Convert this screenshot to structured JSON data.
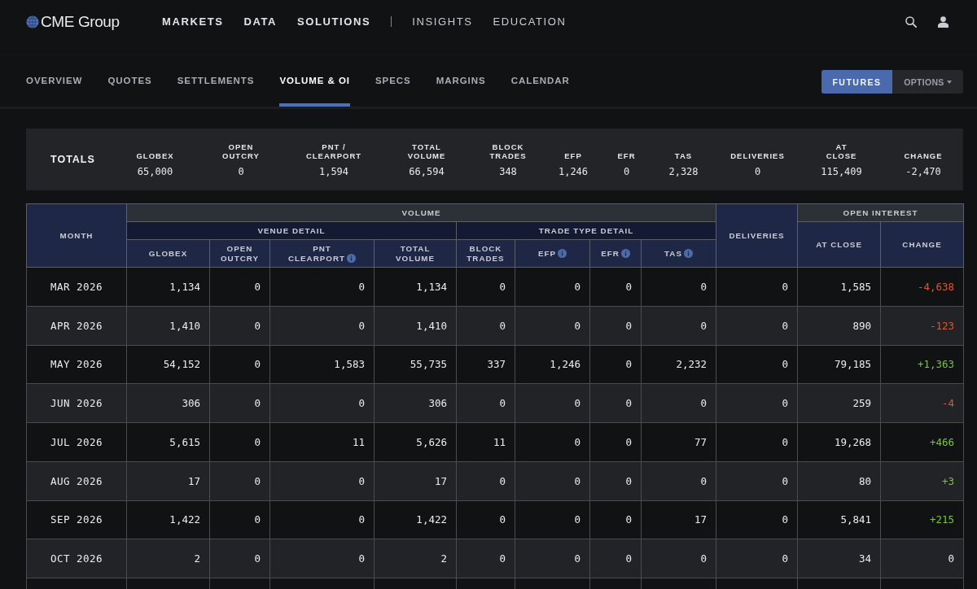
{
  "header": {
    "logo": "CME Group",
    "primary_nav": [
      {
        "label": "MARKETS"
      },
      {
        "label": "DATA"
      },
      {
        "label": "SOLUTIONS"
      }
    ],
    "secondary_nav": [
      {
        "label": "INSIGHTS"
      },
      {
        "label": "EDUCATION"
      }
    ]
  },
  "subnav": {
    "tabs": [
      {
        "label": "OVERVIEW",
        "selected": false
      },
      {
        "label": "QUOTES",
        "selected": false
      },
      {
        "label": "SETTLEMENTS",
        "selected": false
      },
      {
        "label": "VOLUME & OI",
        "selected": true
      },
      {
        "label": "SPECS",
        "selected": false
      },
      {
        "label": "MARGINS",
        "selected": false
      },
      {
        "label": "CALENDAR",
        "selected": false
      }
    ],
    "product_toggle": [
      {
        "label": "FUTURES",
        "selected": true,
        "menu": false
      },
      {
        "label": "OPTIONS",
        "selected": false,
        "menu": true
      }
    ]
  },
  "totals": {
    "title": "TOTALS",
    "columns": [
      {
        "label": "GLOBEX",
        "value": "65,000"
      },
      {
        "label": "OPEN\nOUTCRY",
        "value": "0"
      },
      {
        "label": "PNT /\nCLEARPORT",
        "value": "1,594"
      },
      {
        "label": "TOTAL\nVOLUME",
        "value": "66,594"
      },
      {
        "label": "BLOCK\nTRADES",
        "value": "348"
      },
      {
        "label": "EFP",
        "value": "1,246"
      },
      {
        "label": "EFR",
        "value": "0"
      },
      {
        "label": "TAS",
        "value": "2,328"
      },
      {
        "label": "DELIVERIES",
        "value": "0"
      },
      {
        "label": "AT\nCLOSE",
        "value": "115,409"
      },
      {
        "label": "CHANGE",
        "value": "-2,470"
      }
    ]
  },
  "table": {
    "month_header": "MONTH",
    "volume_header": "VOLUME",
    "deliveries_header": "DELIVERIES",
    "open_interest_header": "OPEN INTEREST",
    "venue_header": "VENUE DETAIL",
    "trade_type_header": "TRADE TYPE DETAIL",
    "venue_columns": [
      {
        "label": "GLOBEX",
        "info": false
      },
      {
        "label": "OPEN\nOUTCRY",
        "info": false
      },
      {
        "label": "PNT\nCLEARPORT",
        "info": true
      },
      {
        "label": "TOTAL\nVOLUME",
        "info": false
      }
    ],
    "trade_type_columns": [
      {
        "label": "BLOCK\nTRADES",
        "info": false
      },
      {
        "label": "EFP",
        "info": true
      },
      {
        "label": "EFR",
        "info": true
      },
      {
        "label": "TAS",
        "info": true
      }
    ],
    "open_interest_columns": [
      {
        "label": "AT CLOSE"
      },
      {
        "label": "CHANGE"
      }
    ],
    "rows": [
      {
        "month": "MAR 2026",
        "cells": [
          "1,134",
          "0",
          "0",
          "1,134",
          "0",
          "0",
          "0",
          "0",
          "0",
          "1,585"
        ],
        "change": "-4,638",
        "kind": "down"
      },
      {
        "month": "APR 2026",
        "cells": [
          "1,410",
          "0",
          "0",
          "1,410",
          "0",
          "0",
          "0",
          "0",
          "0",
          "890"
        ],
        "change": "-123",
        "kind": "down"
      },
      {
        "month": "MAY 2026",
        "cells": [
          "54,152",
          "0",
          "1,583",
          "55,735",
          "337",
          "1,246",
          "0",
          "2,232",
          "0",
          "79,185"
        ],
        "change": "+1,363",
        "kind": "up"
      },
      {
        "month": "JUN 2026",
        "cells": [
          "306",
          "0",
          "0",
          "306",
          "0",
          "0",
          "0",
          "0",
          "0",
          "259"
        ],
        "change": "-4",
        "kind": "down"
      },
      {
        "month": "JUL 2026",
        "cells": [
          "5,615",
          "0",
          "11",
          "5,626",
          "11",
          "0",
          "0",
          "77",
          "0",
          "19,268"
        ],
        "change": "+466",
        "kind": "up"
      },
      {
        "month": "AUG 2026",
        "cells": [
          "17",
          "0",
          "0",
          "17",
          "0",
          "0",
          "0",
          "0",
          "0",
          "80"
        ],
        "change": "+3",
        "kind": "up"
      },
      {
        "month": "SEP 2026",
        "cells": [
          "1,422",
          "0",
          "0",
          "1,422",
          "0",
          "0",
          "0",
          "17",
          "0",
          "5,841"
        ],
        "change": "+215",
        "kind": "up"
      },
      {
        "month": "OCT 2026",
        "cells": [
          "2",
          "0",
          "0",
          "2",
          "0",
          "0",
          "0",
          "0",
          "0",
          "34"
        ],
        "change": "0",
        "kind": "flat"
      }
    ]
  }
}
